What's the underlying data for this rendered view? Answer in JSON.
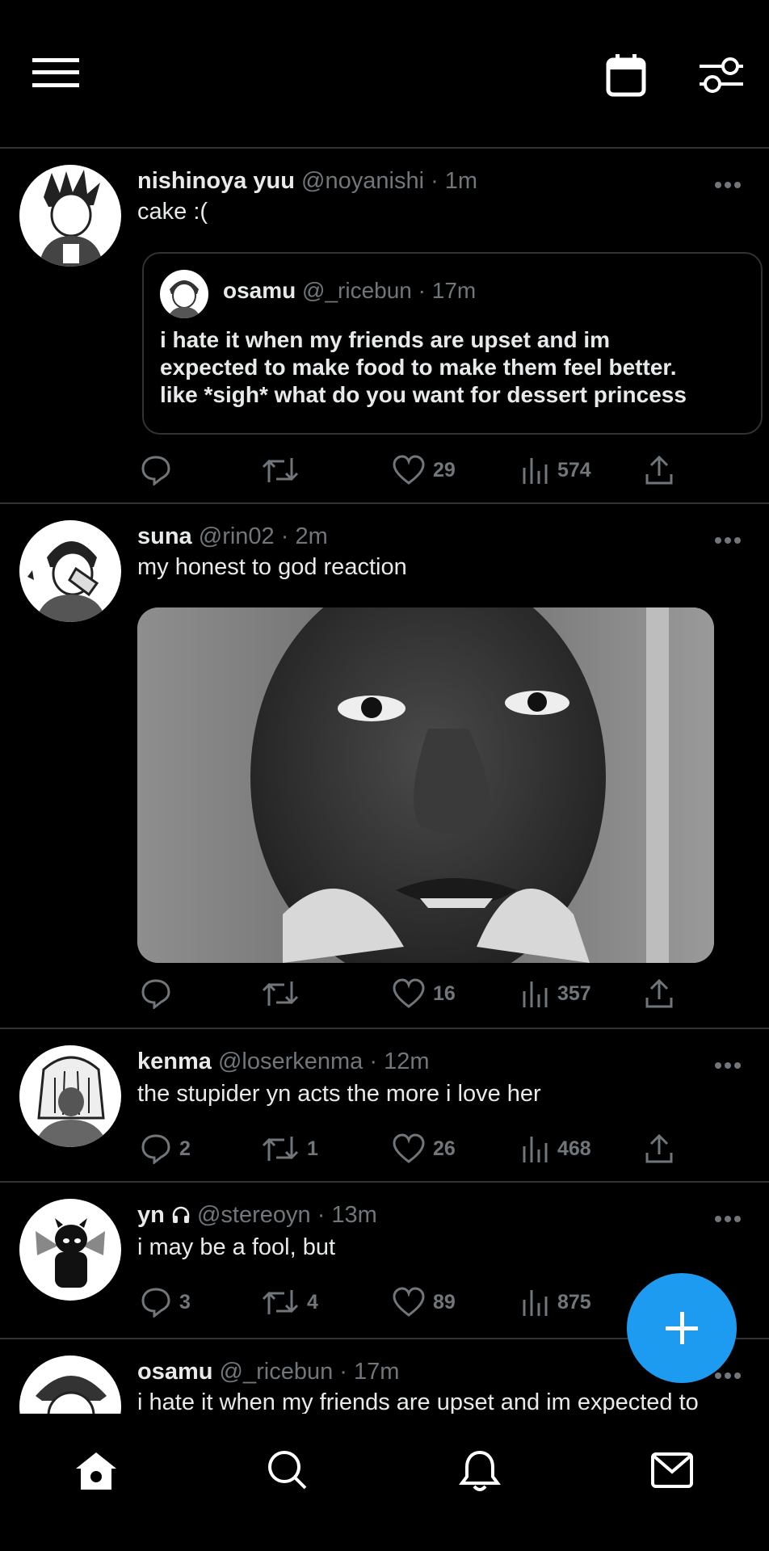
{
  "colors": {
    "background": "#000000",
    "text": "#e7e9ea",
    "muted": "#71767b",
    "divider": "#2f3336",
    "accent": "#1d9bf0"
  },
  "header": {
    "menu_icon": "hamburger-icon",
    "calendar_icon": "calendar-icon",
    "settings_icon": "sliders-icon"
  },
  "tweets": [
    {
      "name": "nishinoya yuu",
      "meta": "@noyanishi · 1m",
      "text": "cake :(",
      "quote": {
        "name": "osamu",
        "meta": "@_ricebun · 17m",
        "lines": [
          "i hate it when my friends are upset and im",
          "expected to make food to make them feel better.",
          "like *sigh* what do you want for dessert princess"
        ]
      },
      "replies": "",
      "retweets": "",
      "likes": "29",
      "views": "574"
    },
    {
      "name": "suna",
      "meta": "@rin02 · 2m",
      "text": "my honest to god reaction",
      "replies": "",
      "retweets": "",
      "likes": "16",
      "views": "357"
    },
    {
      "name": "kenma",
      "meta": "@loserkenma · 12m",
      "text": "the stupider yn acts the more i love her",
      "replies": "2",
      "retweets": "1",
      "likes": "26",
      "views": "468"
    },
    {
      "name": "yn",
      "meta": "@stereoyn · 13m",
      "text": "i may be a fool, but",
      "replies": "3",
      "retweets": "4",
      "likes": "89",
      "views": "875"
    },
    {
      "name": "osamu",
      "meta": "@_ricebun · 17m",
      "text": "i hate it when my friends are upset and im expected to"
    }
  ],
  "compose": {
    "icon": "plus-icon"
  },
  "bottom_nav": [
    "home-icon",
    "search-icon",
    "bell-icon",
    "mail-icon"
  ]
}
